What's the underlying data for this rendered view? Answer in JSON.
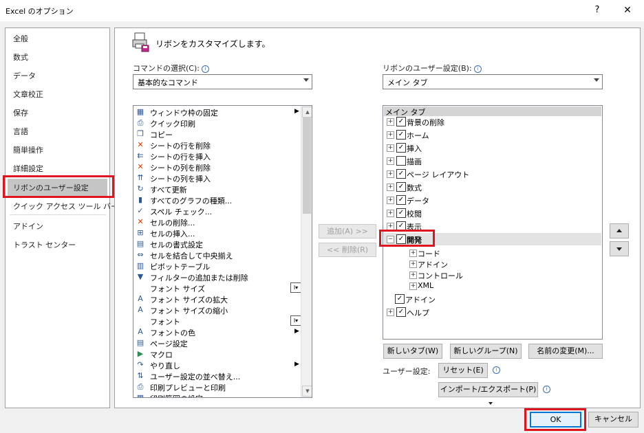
{
  "window": {
    "title": "Excel のオプション",
    "help_glyph": "?",
    "close_glyph": "✕"
  },
  "sidebar": {
    "items": [
      "全般",
      "数式",
      "データ",
      "文章校正",
      "保存",
      "言語",
      "簡単操作",
      "詳細設定",
      "リボンのユーザー設定",
      "クイック アクセス ツール バー",
      "アドイン",
      "トラスト センター"
    ],
    "selected": "リボンのユーザー設定"
  },
  "main": {
    "heading": "リボンをカスタマイズします。",
    "commands_label": "コマンドの選択(C):",
    "commands_value": "基本的なコマンド",
    "ribbon_label": "リボンのユーザー設定(B):",
    "ribbon_value": "メイン タブ",
    "commands": [
      {
        "label": "ウィンドウ枠の固定",
        "icon": "freeze-panes-icon",
        "glyph": "▦",
        "extra": "submenu"
      },
      {
        "label": "クイック印刷",
        "icon": "quick-print-icon",
        "glyph": "⎙"
      },
      {
        "label": "コピー",
        "icon": "copy-icon",
        "glyph": "❐"
      },
      {
        "label": "シートの行を削除",
        "icon": "delete-rows-icon",
        "glyph": "✕"
      },
      {
        "label": "シートの行を挿入",
        "icon": "insert-rows-icon",
        "glyph": "⇇"
      },
      {
        "label": "シートの列を削除",
        "icon": "delete-columns-icon",
        "glyph": "✕"
      },
      {
        "label": "シートの列を挿入",
        "icon": "insert-columns-icon",
        "glyph": "⇈"
      },
      {
        "label": "すべて更新",
        "icon": "refresh-all-icon",
        "glyph": "↻"
      },
      {
        "label": "すべてのグラフの種類...",
        "icon": "chart-types-icon",
        "glyph": "▮"
      },
      {
        "label": "スペル チェック...",
        "icon": "spell-check-icon",
        "glyph": "✓"
      },
      {
        "label": "セルの削除...",
        "icon": "delete-cells-icon",
        "glyph": "✕"
      },
      {
        "label": "セルの挿入...",
        "icon": "insert-cells-icon",
        "glyph": "⊞"
      },
      {
        "label": "セルの書式設定",
        "icon": "format-cells-icon",
        "glyph": "▤"
      },
      {
        "label": "セルを結合して中央揃え",
        "icon": "merge-center-icon",
        "glyph": "⇔"
      },
      {
        "label": "ピボットテーブル",
        "icon": "pivot-table-icon",
        "glyph": "▥"
      },
      {
        "label": "フィルターの追加または削除",
        "icon": "filter-icon",
        "glyph": "▼"
      },
      {
        "label": "フォント サイズ",
        "icon": "font-size-icon",
        "glyph": "",
        "extra": "box"
      },
      {
        "label": "フォント サイズの拡大",
        "icon": "grow-font-icon",
        "glyph": "A"
      },
      {
        "label": "フォント サイズの縮小",
        "icon": "shrink-font-icon",
        "glyph": "A"
      },
      {
        "label": "フォント",
        "icon": "font-icon",
        "glyph": "",
        "extra": "box"
      },
      {
        "label": "フォントの色",
        "icon": "font-color-icon",
        "glyph": "A",
        "extra": "submenu"
      },
      {
        "label": "ページ設定",
        "icon": "page-setup-icon",
        "glyph": "▤"
      },
      {
        "label": "マクロ",
        "icon": "macro-icon",
        "glyph": "▶"
      },
      {
        "label": "やり直し",
        "icon": "redo-icon",
        "glyph": "↷",
        "extra": "submenu"
      },
      {
        "label": "ユーザー設定の並べ替え...",
        "icon": "custom-sort-icon",
        "glyph": "⇅"
      },
      {
        "label": "印刷プレビューと印刷",
        "icon": "print-preview-icon",
        "glyph": "⎙"
      },
      {
        "label": "印刷範囲の設定",
        "icon": "print-area-icon",
        "glyph": "▦"
      }
    ],
    "add_button": "追加(A) >>",
    "remove_button": "<< 削除(R)",
    "tree_header": "メイン タブ",
    "tree": [
      {
        "label": "背景の削除",
        "checked": true,
        "level": 0,
        "expand": true
      },
      {
        "label": "ホーム",
        "checked": true,
        "level": 0,
        "expand": true
      },
      {
        "label": "挿入",
        "checked": true,
        "level": 0,
        "expand": true
      },
      {
        "label": "描画",
        "checked": false,
        "level": 0,
        "expand": true
      },
      {
        "label": "ページ レイアウト",
        "checked": true,
        "level": 0,
        "expand": true
      },
      {
        "label": "数式",
        "checked": true,
        "level": 0,
        "expand": true
      },
      {
        "label": "データ",
        "checked": true,
        "level": 0,
        "expand": true
      },
      {
        "label": "校閲",
        "checked": true,
        "level": 0,
        "expand": true
      },
      {
        "label": "表示",
        "checked": true,
        "level": 0,
        "expand": true
      },
      {
        "label": "開発",
        "checked": true,
        "level": 0,
        "expand": true,
        "expanded": true,
        "bold": true,
        "selected": true
      },
      {
        "label": "コード",
        "level": 1,
        "expand": true
      },
      {
        "label": "アドイン",
        "level": 1,
        "expand": true
      },
      {
        "label": "コントロール",
        "level": 1,
        "expand": true
      },
      {
        "label": "XML",
        "level": 1,
        "expand": true
      },
      {
        "label": "アドイン",
        "checked": true,
        "level": 0,
        "expand": false
      },
      {
        "label": "ヘルプ",
        "checked": true,
        "level": 0,
        "expand": true
      }
    ],
    "new_tab_button": "新しいタブ(W)",
    "new_group_button": "新しいグループ(N)",
    "rename_button": "名前の変更(M)...",
    "user_settings_label": "ユーザー設定:",
    "reset_button": "リセット(E)",
    "import_export_button": "インポート/エクスポート(P)"
  },
  "footer": {
    "ok": "OK",
    "cancel": "キャンセル"
  },
  "colors": {
    "highlight": "#e0141e",
    "ok_border": "#0078d7"
  }
}
